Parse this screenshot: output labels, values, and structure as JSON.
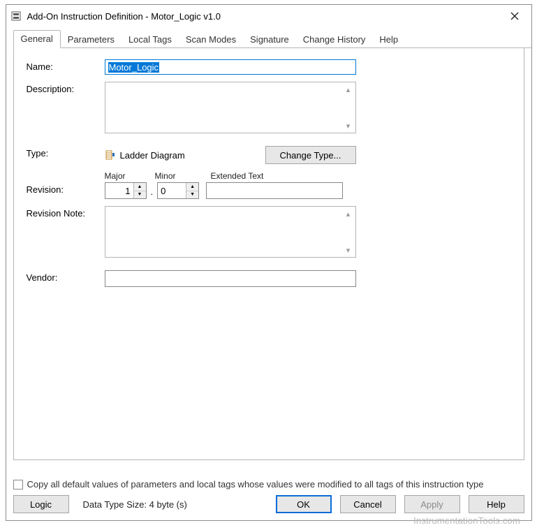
{
  "window": {
    "title": "Add-On Instruction Definition - Motor_Logic v1.0"
  },
  "tabs": {
    "general": "General",
    "parameters": "Parameters",
    "local_tags": "Local Tags",
    "scan_modes": "Scan Modes",
    "signature": "Signature",
    "change_hist": "Change History",
    "help": "Help"
  },
  "form": {
    "name_label": "Name:",
    "name_value": "Motor_Logic",
    "desc_label": "Description:",
    "desc_value": "",
    "type_label": "Type:",
    "type_value": "Ladder Diagram",
    "change_type_btn": "Change Type...",
    "rev_label": "Revision:",
    "rev_major_label": "Major",
    "rev_minor_label": "Minor",
    "rev_ext_label": "Extended Text",
    "rev_major": "1",
    "rev_minor": "0",
    "rev_ext": "",
    "rev_note_label": "Revision Note:",
    "rev_note_value": "",
    "vendor_label": "Vendor:",
    "vendor_value": ""
  },
  "bottom": {
    "copy_label": "Copy all default values of parameters and local tags whose values were modified to all tags of this instruction type",
    "logic_btn": "Logic",
    "data_size": "Data Type Size: 4 byte (s)",
    "ok_btn": "OK",
    "cancel_btn": "Cancel",
    "apply_btn": "Apply",
    "help_btn": "Help"
  },
  "watermark": "InstrumentationTools.com"
}
